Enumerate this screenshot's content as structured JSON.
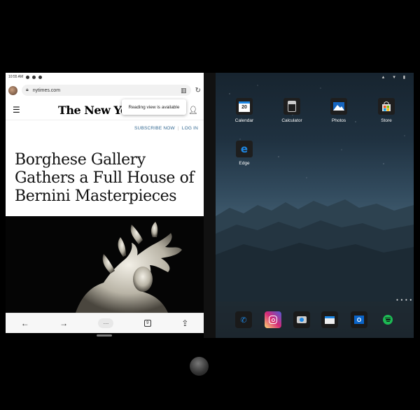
{
  "left_screen": {
    "status_time": "10:55 AM",
    "url": "nytimes.com",
    "reading_view_tooltip": "Reading view is available",
    "masthead": "The New York",
    "subscribe_label": "SUBSCRIBE NOW",
    "subnav_separator": "|",
    "login_label": "LOG IN",
    "headline": "Borghese Gallery Gathers a Full House of Bernini Masterpieces",
    "bottom_bar": {
      "back_icon": "←",
      "forward_icon": "→",
      "more_icon": "···",
      "tabs_count": "9",
      "share_icon": "⇪"
    }
  },
  "right_screen": {
    "apps": [
      {
        "label": "Calendar",
        "icon": "calendar-icon",
        "badge": "20"
      },
      {
        "label": "Calculator",
        "icon": "calculator-icon"
      },
      {
        "label": "Photos",
        "icon": "photos-icon"
      },
      {
        "label": "Store",
        "icon": "store-icon"
      },
      {
        "label": "Edge",
        "icon": "edge-icon"
      }
    ],
    "dock": [
      "phone-icon",
      "instagram-icon",
      "camera-icon",
      "news-icon",
      "outlook-icon",
      "spotify-icon"
    ]
  },
  "colors": {
    "nyt_link": "#326891",
    "edge_blue": "#1e88e5",
    "spotify_green": "#1db954",
    "outlook_blue": "#0a64c8"
  }
}
